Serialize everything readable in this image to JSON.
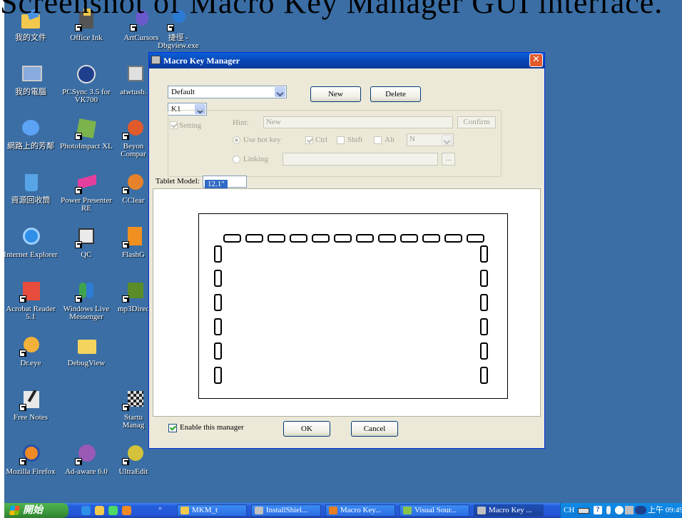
{
  "overlay_title": "Screenshot of Macro Key Manager GUI interface.",
  "desktop": {
    "icons": [
      {
        "label": "我的文件",
        "color": "#f2c94c"
      },
      {
        "label": "Office Ink",
        "color": "#444"
      },
      {
        "label": "ArtCursors",
        "color": "#6a5acd"
      },
      {
        "label": "捷徑 - Dbgview.exe",
        "color": "#2b7bd6"
      },
      {
        "label": "我的電腦",
        "color": "#88aadd"
      },
      {
        "label": "PCSync 3.5 for VK700",
        "color": "#1e3f8c"
      },
      {
        "label": "atwtusb.",
        "color": "#e0e0e0"
      },
      {
        "label": "網路上的芳鄰",
        "color": "#5da3f5"
      },
      {
        "label": "PhotoImpact XL",
        "color": "#7bb34d"
      },
      {
        "label": "Beyon Compar",
        "color": "#e05a2b"
      },
      {
        "label": "資源回收筒",
        "color": "#57a4e6"
      },
      {
        "label": "Power Presenter RE",
        "color": "#e43f9d"
      },
      {
        "label": "CClear",
        "color": "#e6822b"
      },
      {
        "label": "Internet Explorer",
        "color": "#2d8fe8"
      },
      {
        "label": "QC",
        "color": "#eaeaea"
      },
      {
        "label": "FlashG",
        "color": "#f09020"
      },
      {
        "label": "Acrobat Reader 5.1",
        "color": "#e74c3c"
      },
      {
        "label": "Windows Live Messenger",
        "color": "#3fa34d"
      },
      {
        "label": "mp3Direc",
        "color": "#5b8c2a"
      },
      {
        "label": "Dr.eye",
        "color": "#f3b13a"
      },
      {
        "label": "DebugView",
        "color": "#f4d35e"
      },
      {
        "label": "Free Notes",
        "color": "#e8e8e8"
      },
      {
        "label": "Startu Manag",
        "color": "#cccccc"
      },
      {
        "label": "Mozilla Firefox",
        "color": "#f08a24"
      },
      {
        "label": "Ad-aware 6.0",
        "color": "#9b59b6"
      },
      {
        "label": "UltraEdit",
        "color": "#d4c23a"
      }
    ]
  },
  "dialog": {
    "title": "Macro Key Manager",
    "profile_select": "Default",
    "new_label": "New",
    "delete_label": "Delete",
    "key_select": "K1",
    "setting_label": "Setting",
    "hint_label": "Hint:",
    "hint_value": "New",
    "confirm_label": "Confirm",
    "use_hot_key_label": "Use hot key",
    "ctrl_label": "Ctrl",
    "shift_label": "Shift",
    "alt_label": "Alt",
    "hotkey_select": "N",
    "linking_label": "Linking",
    "browse_label": "...",
    "tablet_model_label": "Tablet Model:",
    "tablet_model_value": "12.1\"",
    "enable_label": "Enable this manager",
    "ok_label": "OK",
    "cancel_label": "Cancel"
  },
  "taskbar": {
    "start_label": "開始",
    "buttons": [
      {
        "label": "MKM_t",
        "color": "#f2c94c"
      },
      {
        "label": "InstallShiel...",
        "color": "#c0c0c0"
      },
      {
        "label": "Macro Key...",
        "color": "#e67e22"
      },
      {
        "label": "Visual Sour...",
        "color": "#8bc34a"
      },
      {
        "label": "Macro Key ...",
        "color": "#c0c0c0"
      }
    ],
    "lang": "CH",
    "clock": "上午 09:49"
  }
}
